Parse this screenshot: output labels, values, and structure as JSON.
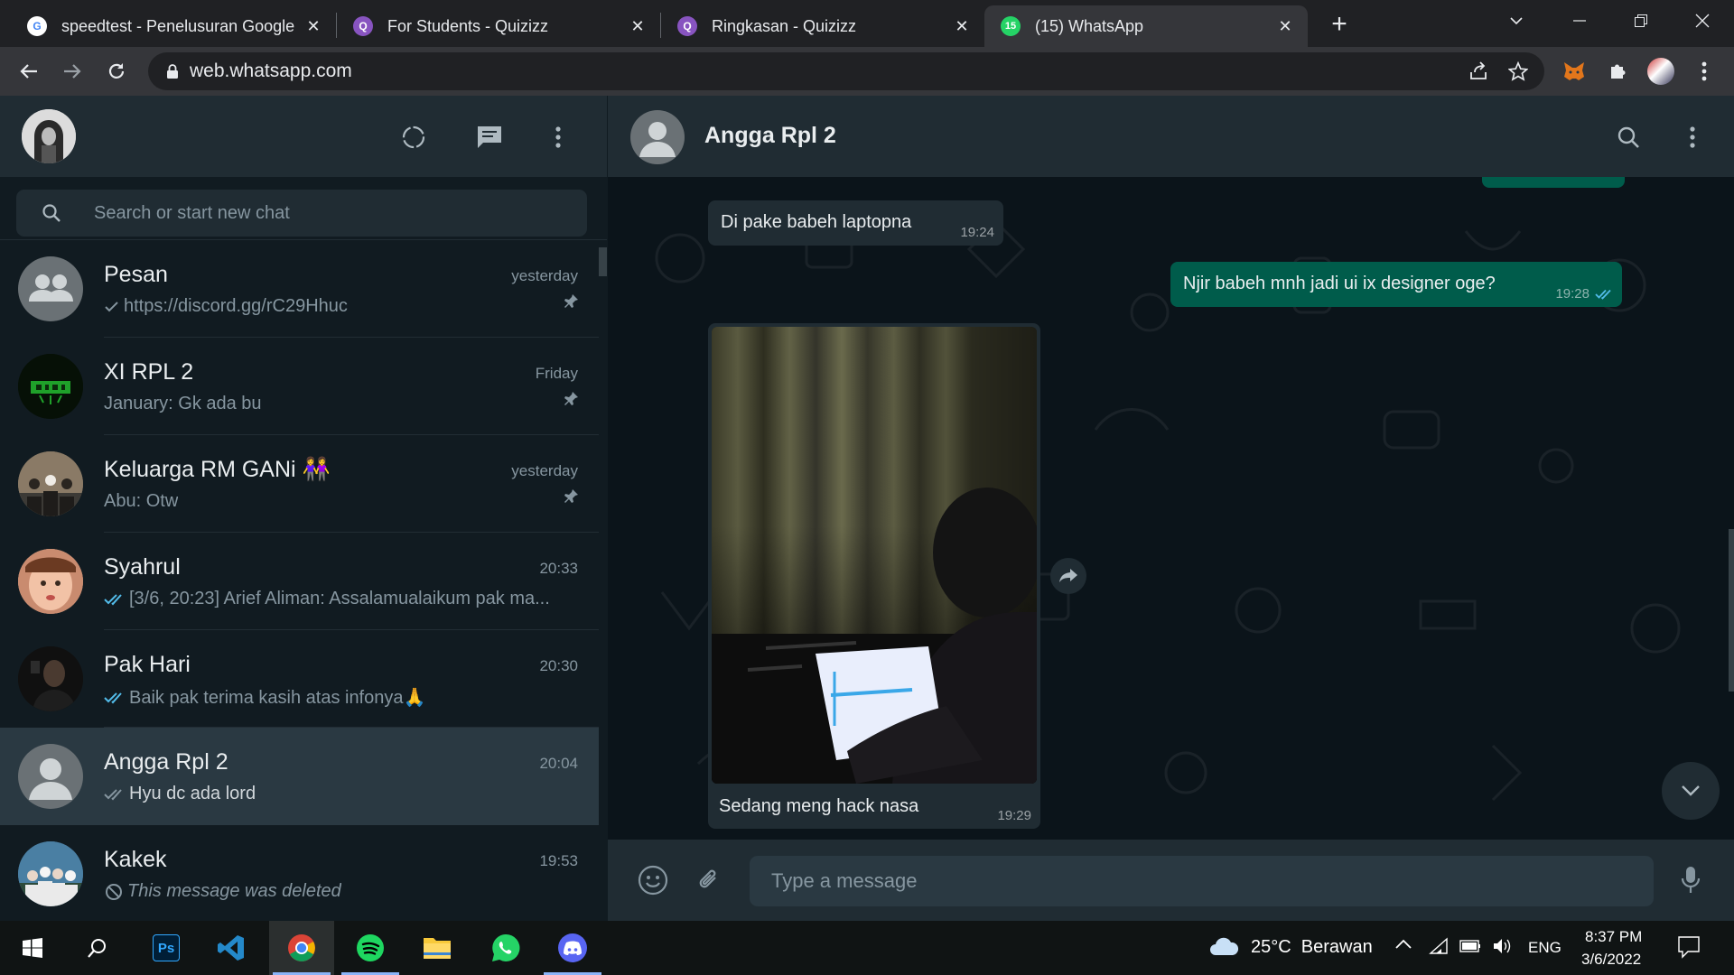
{
  "browser": {
    "tabs": [
      {
        "title": "speedtest - Penelusuran Google",
        "icon": "google-icon"
      },
      {
        "title": "For Students - Quizizz",
        "icon": "quizizz-icon"
      },
      {
        "title": "Ringkasan - Quizizz",
        "icon": "quizizz-icon"
      },
      {
        "title": "(15) WhatsApp",
        "icon": "whatsapp-icon",
        "badge": "15",
        "active": true
      }
    ],
    "new_tab": "+",
    "url": "web.whatsapp.com"
  },
  "sidebar": {
    "search_placeholder": "Search or start new chat",
    "chats": [
      {
        "name": "Pesan",
        "time": "yesterday",
        "last": "https://discord.gg/rC29Hhuc",
        "tick": "single",
        "pinned": true,
        "avatar": "group-default"
      },
      {
        "name": "XI RPL 2",
        "time": "Friday",
        "last": "January: Gk ada bu",
        "tick": "none",
        "pinned": true,
        "avatar": "green-logo"
      },
      {
        "name": "Keluarga RM GANi 👭",
        "time": "yesterday",
        "last": "Abu: Otw",
        "tick": "none",
        "pinned": true,
        "avatar": "family-photo"
      },
      {
        "name": "Syahrul",
        "time": "20:33",
        "last": "[3/6, 20:23] Arief Aliman: Assalamualaikum pak ma...",
        "tick": "double-blue",
        "pinned": false,
        "avatar": "child-photo"
      },
      {
        "name": "Pak Hari",
        "time": "20:30",
        "last": "Baik pak terima kasih atas infonya🙏",
        "tick": "double-blue",
        "pinned": false,
        "avatar": "man-dark-photo"
      },
      {
        "name": "Angga Rpl 2",
        "time": "20:04",
        "last": "Hyu dc ada lord",
        "tick": "double-grey",
        "pinned": false,
        "avatar": "default",
        "selected": true
      },
      {
        "name": "Kakek",
        "time": "19:53",
        "last": "This message was deleted",
        "tick": "deleted",
        "pinned": false,
        "avatar": "family-group-photo"
      }
    ]
  },
  "conversation": {
    "contact_name": "Angga Rpl 2",
    "messages": [
      {
        "dir": "in",
        "text": "Di pake babeh laptopna",
        "time": "19:24"
      },
      {
        "dir": "out",
        "text": "Njir babeh mnh jadi ui ix designer oge?",
        "time": "19:28",
        "tick": "double-blue"
      },
      {
        "dir": "in",
        "type": "image",
        "caption": "Sedang meng hack nasa",
        "time": "19:29"
      }
    ],
    "input_placeholder": "Type a message"
  },
  "taskbar": {
    "weather": "25°C  Berawan",
    "language": "ENG",
    "time": "8:37 PM",
    "date": "3/6/2022",
    "apps": [
      "windows-start",
      "search",
      "photoshop",
      "vscode",
      "chrome",
      "spotify",
      "file-explorer",
      "whatsapp",
      "discord"
    ]
  },
  "colors": {
    "wa_panel": "#202c33",
    "wa_bg": "#0b141a",
    "wa_out_bubble": "#005c4b",
    "wa_tick_blue": "#53bdeb",
    "wa_selected": "#2a3942"
  }
}
